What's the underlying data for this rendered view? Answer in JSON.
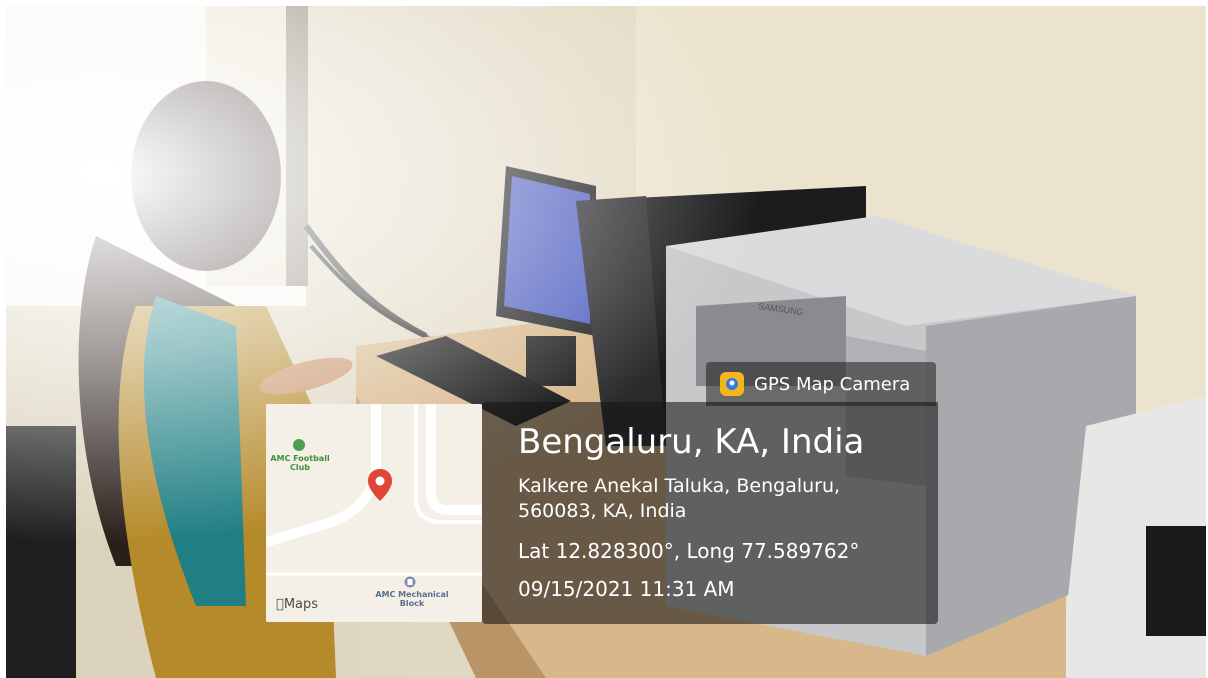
{
  "app": {
    "name": "GPS Map Camera",
    "icon": "gps-map-camera-icon",
    "accent": "#f3b51b"
  },
  "location": {
    "title": "Bengaluru, KA, India",
    "address_line1": "Kalkere Anekal Taluka, Bengaluru,",
    "address_line2": "560083, KA, India",
    "coordinates": "Lat 12.828300°, Long 77.589762°",
    "datetime": "09/15/2021 11:31 AM"
  },
  "map": {
    "brand": "Maps",
    "pin_color": "#e0453a",
    "poi": [
      {
        "name": "AMC Football Club",
        "line1": "AMC Football",
        "line2": "Club",
        "icon": "sports-icon"
      },
      {
        "name": "AMC Mechanical Block",
        "line1": "AMC Mechanical",
        "line2": "Block",
        "icon": "building-icon"
      }
    ]
  },
  "photo": {
    "monitor_brand": "SAMSUNG"
  }
}
